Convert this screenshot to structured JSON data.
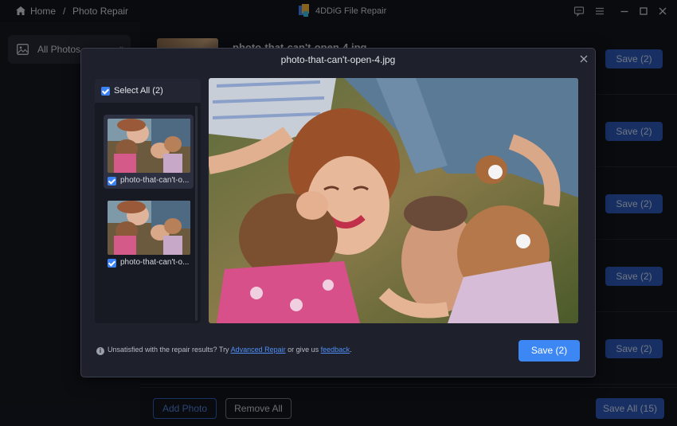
{
  "titlebar": {
    "home_label": "Home",
    "separator": "/",
    "page_label": "Photo Repair",
    "app_title": "4DDiG File Repair",
    "icons": [
      "home-icon",
      "app-logo-icon",
      "feedback-icon",
      "menu-icon",
      "minimize-icon",
      "maximize-icon",
      "close-icon"
    ]
  },
  "sidebar": {
    "items": [
      {
        "label": "All Photos",
        "icon": "photo-icon",
        "arrow": "«"
      }
    ]
  },
  "main": {
    "rows": [
      {
        "name": "photo-that-can't-open-4.jpg",
        "save_label": "Save (2)"
      },
      {
        "name": "",
        "save_label": "Save (2)"
      },
      {
        "name": "",
        "save_label": "Save (2)"
      },
      {
        "name": "",
        "save_label": "Save (2)"
      },
      {
        "name": "",
        "save_label": "Save (2)"
      }
    ]
  },
  "footer": {
    "add_photo": "Add Photo",
    "remove_all": "Remove All",
    "save_all": "Save All (15)"
  },
  "modal": {
    "title": "photo-that-can't-open-4.jpg",
    "select_all": "Select All (2)",
    "thumbnails": [
      {
        "filename": "photo-that-can't-o...",
        "checked": true,
        "selected": true
      },
      {
        "filename": "photo-that-can't-o...",
        "checked": true,
        "selected": false
      }
    ],
    "notice": {
      "prefix": "Unsatisfied with the repair results? Try ",
      "link1": "Advanced Repair",
      "middle": " or give us ",
      "link2": "feedback",
      "suffix": "."
    },
    "save_label": "Save (2)"
  },
  "colors": {
    "accent": "#3d87f5",
    "button_dim": "#2a56b3",
    "background": "#13151c",
    "modal_bg": "#1e202b"
  }
}
